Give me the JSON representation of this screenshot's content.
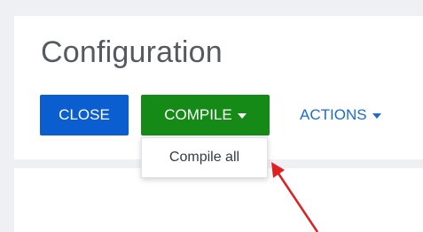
{
  "page": {
    "title": "Configuration"
  },
  "toolbar": {
    "close_label": "CLOSE",
    "compile_label": "COMPILE",
    "actions_label": "ACTIONS"
  },
  "compile_menu": {
    "items": [
      {
        "label": "Compile all"
      }
    ]
  },
  "colors": {
    "background": "#eef0f3",
    "close_button": "#0b5ed0",
    "compile_button": "#168a17",
    "actions_link": "#1a6cd0",
    "annotation_arrow": "#e02020"
  },
  "icons": {
    "dropdown_caret": "caret-down-icon",
    "annotation": "red-arrow-icon"
  }
}
